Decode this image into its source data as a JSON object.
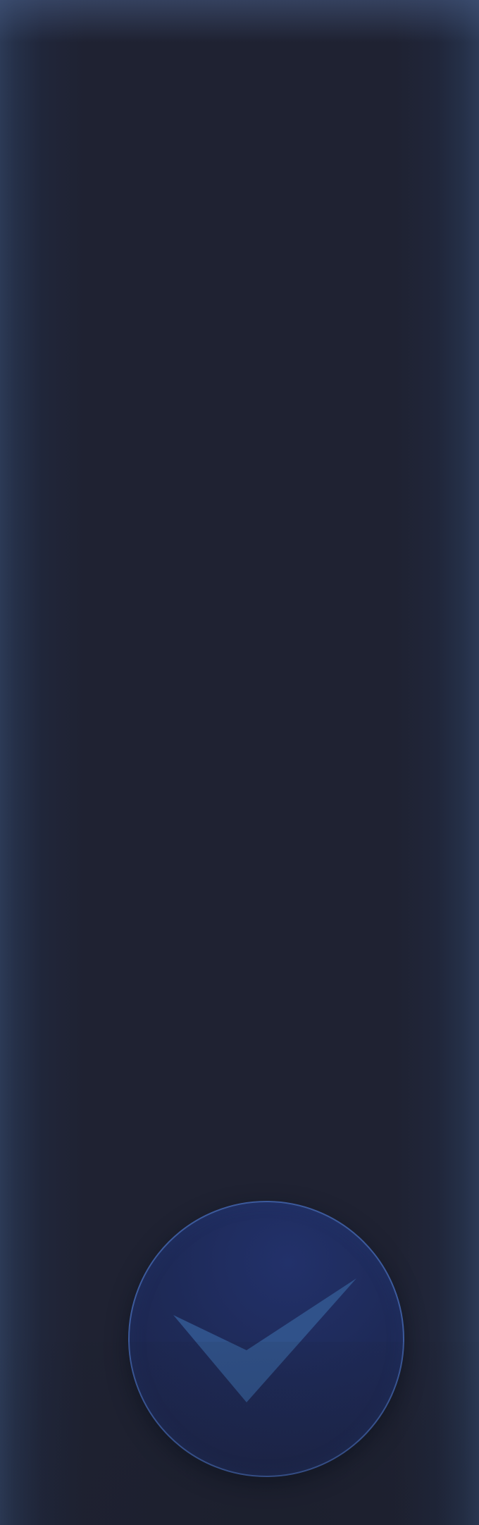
{
  "window": {
    "background": "#1f2232",
    "edge_glow": "#2c3a56"
  },
  "actions": {
    "confirm": {
      "icon": "check-icon",
      "button_fill": "#1e2a58",
      "button_border": "#3c5a9c",
      "icon_color": "#30528a"
    }
  }
}
